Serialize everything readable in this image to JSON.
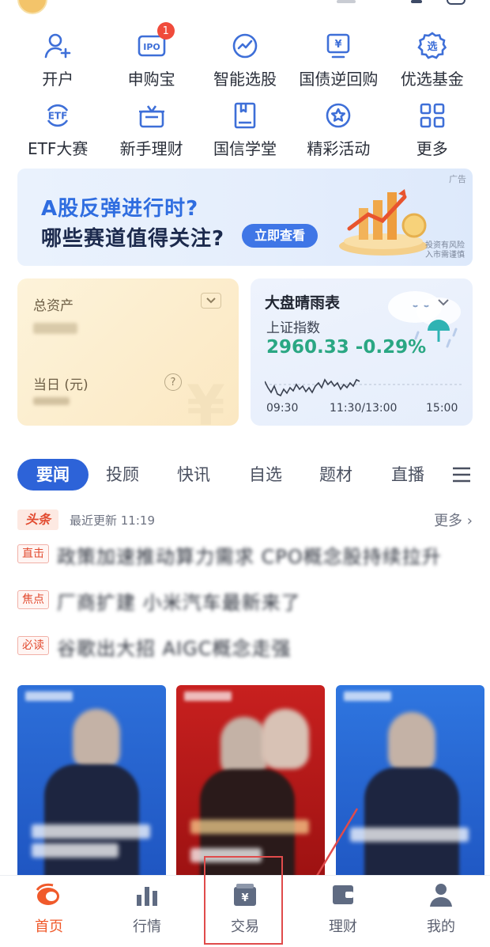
{
  "quick_grid": {
    "row1": [
      {
        "label": "开户",
        "icon": "person-add-icon"
      },
      {
        "label": "申购宝",
        "icon": "ipo-icon",
        "badge": "1",
        "icon_text": "IPO"
      },
      {
        "label": "智能选股",
        "icon": "trend-circle-icon"
      },
      {
        "label": "国债逆回购",
        "icon": "yen-doc-icon",
        "icon_text": "¥"
      },
      {
        "label": "优选基金",
        "icon": "xuan-badge-icon",
        "icon_text": "选"
      }
    ],
    "row2": [
      {
        "label": "ETF大赛",
        "icon": "etf-icon",
        "icon_text": "ETF"
      },
      {
        "label": "新手理财",
        "icon": "gift-box-icon"
      },
      {
        "label": "国信学堂",
        "icon": "book-icon"
      },
      {
        "label": "精彩活动",
        "icon": "star-circle-icon"
      },
      {
        "label": "更多",
        "icon": "grid-more-icon"
      }
    ]
  },
  "banner": {
    "line1": "A股反弹进行时?",
    "line2": "哪些赛道值得关注?",
    "cta": "立即查看",
    "ad_tag": "广告",
    "risk_note": "投资有风险 入市需谨慎"
  },
  "assets_card": {
    "title": "总资产",
    "today_label": "当日",
    "today_unit": "(元)",
    "help": "?"
  },
  "weather_card": {
    "title": "大盘晴雨表",
    "index_name": "上证指数",
    "index_value": "2960.33",
    "index_change": "-0.29%",
    "ticks": [
      "09:30",
      "11:30/13:00",
      "15:00"
    ],
    "colors": {
      "up_green": "#2aa783"
    }
  },
  "news_tabs": {
    "items": [
      "要闻",
      "投顾",
      "快讯",
      "自选",
      "题材",
      "直播"
    ],
    "active": "要闻"
  },
  "headlines": {
    "logo": "头条",
    "updated": "最近更新 11:19",
    "more": "更多",
    "items": [
      {
        "tag": "直击",
        "text": "政策加速推动算力需求 CPO概念股持续拉升"
      },
      {
        "tag": "焦点",
        "text": "厂商扩建 小米汽车最新来了"
      },
      {
        "tag": "必读",
        "text": "谷歌出大招 AIGC概念走强"
      }
    ]
  },
  "tabbar": {
    "items": [
      {
        "label": "首页",
        "icon": "home-flame-icon",
        "active": true
      },
      {
        "label": "行情",
        "icon": "bar-chart-icon",
        "active": false
      },
      {
        "label": "交易",
        "icon": "wallet-yen-icon",
        "active": false,
        "icon_text": "¥"
      },
      {
        "label": "理财",
        "icon": "wallet-icon",
        "active": false
      },
      {
        "label": "我的",
        "icon": "person-icon",
        "active": false
      }
    ]
  },
  "colors": {
    "brand_blue": "#2d63d8",
    "accent_orange": "#f05a2b",
    "annotation_red": "#e04b4b"
  }
}
